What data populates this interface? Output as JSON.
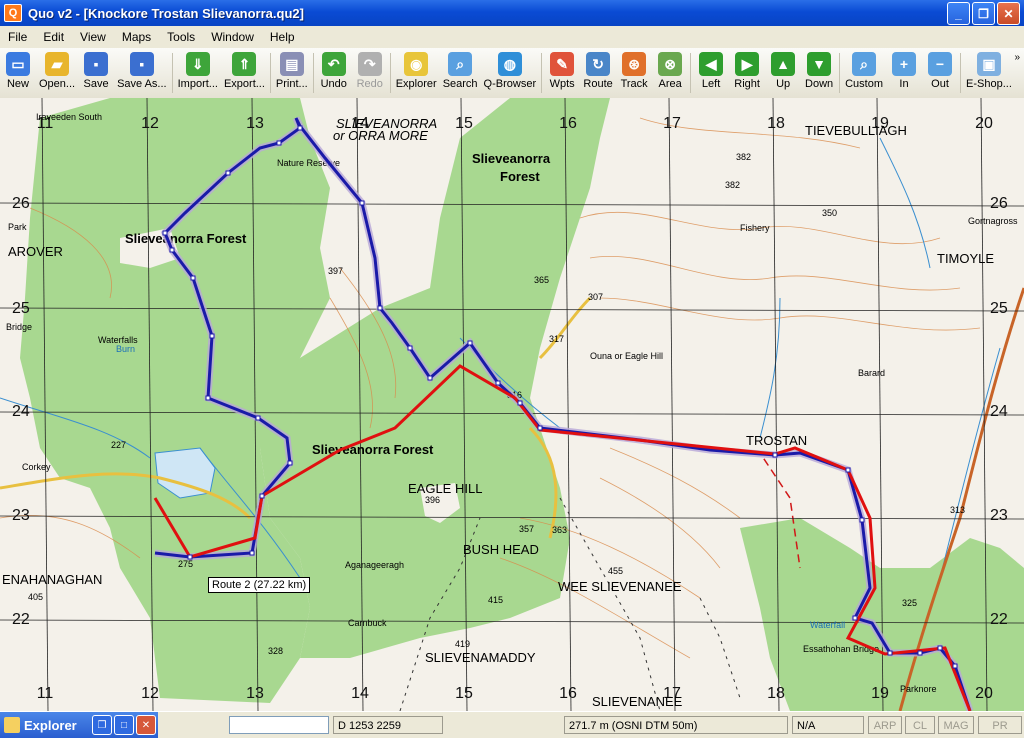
{
  "window": {
    "title": "Quo v2 - [Knockore Trostan Slievanorra.qu2]",
    "app_icon_letter": "Q",
    "min_label": "_",
    "max_label": "❐",
    "close_label": "✕"
  },
  "menu": [
    "File",
    "Edit",
    "View",
    "Maps",
    "Tools",
    "Window",
    "Help"
  ],
  "toolbar": [
    {
      "label": "New",
      "icon": "new-doc-icon",
      "color": "#3b7be0"
    },
    {
      "label": "Open...",
      "icon": "folder-icon",
      "color": "#e8b52c"
    },
    {
      "label": "Save",
      "icon": "floppy-icon",
      "color": "#3b6fd0"
    },
    {
      "label": "Save As...",
      "icon": "floppy-as-icon",
      "color": "#3b6fd0"
    },
    {
      "label": "Import...",
      "icon": "import-icon",
      "color": "#3ea53a"
    },
    {
      "label": "Export...",
      "icon": "export-icon",
      "color": "#3ea53a"
    },
    {
      "label": "Print...",
      "icon": "printer-icon",
      "color": "#8a8fb5"
    },
    {
      "label": "Undo",
      "icon": "undo-arrow-icon",
      "color": "#3ea53a"
    },
    {
      "label": "Redo",
      "icon": "redo-arrow-icon",
      "color": "#b0b0b0",
      "disabled": true
    },
    {
      "label": "Explorer",
      "icon": "explorer-icon",
      "color": "#e8c53a"
    },
    {
      "label": "Search",
      "icon": "search-icon",
      "color": "#5aa0e0"
    },
    {
      "label": "Q-Browser",
      "icon": "globe-icon",
      "color": "#2f8fd8"
    },
    {
      "label": "Wpts",
      "icon": "waypoint-icon",
      "color": "#e0533a"
    },
    {
      "label": "Route",
      "icon": "route-icon",
      "color": "#4a86c8"
    },
    {
      "label": "Track",
      "icon": "track-icon",
      "color": "#e0702a"
    },
    {
      "label": "Area",
      "icon": "area-icon",
      "color": "#6aa84f"
    },
    {
      "label": "Left",
      "icon": "arrow-left-icon",
      "color": "#2e9e2e"
    },
    {
      "label": "Right",
      "icon": "arrow-right-icon",
      "color": "#2e9e2e"
    },
    {
      "label": "Up",
      "icon": "arrow-up-icon",
      "color": "#2e9e2e"
    },
    {
      "label": "Down",
      "icon": "arrow-down-icon",
      "color": "#2e9e2e"
    },
    {
      "label": "Custom",
      "icon": "zoom-custom-icon",
      "color": "#5aa0e0"
    },
    {
      "label": "In",
      "icon": "zoom-in-icon",
      "color": "#5aa0e0"
    },
    {
      "label": "Out",
      "icon": "zoom-out-icon",
      "color": "#5aa0e0"
    },
    {
      "label": "E-Shop...",
      "icon": "shop-icon",
      "color": "#7fb0e0"
    }
  ],
  "map": {
    "grid_top": [
      "11",
      "12",
      "13",
      "14",
      "15",
      "16",
      "17",
      "18",
      "19",
      "20"
    ],
    "grid_bottom": [
      "11",
      "12",
      "13",
      "14",
      "15",
      "16",
      "17",
      "18",
      "19",
      "20"
    ],
    "grid_left": [
      "26",
      "25",
      "24",
      "23",
      "22"
    ],
    "grid_right": [
      "26",
      "25",
      "24",
      "23",
      "22"
    ],
    "labels_large": [
      "SLIEVEANORRA",
      "or ORRA MORE",
      "TIEVEBULLIAGH",
      "TIMOYLE",
      "TROSTAN",
      "EAGLE HILL",
      "BUSH HEAD",
      "WEE SLIEVENANEE",
      "SLIEVENAMADDY",
      "SLIEVENANEE",
      "ENAHANAGHAN",
      "AROVER"
    ],
    "labels_forest": [
      "Slieveanorra Forest",
      "Slieveanorra",
      "Forest",
      "Slieveanorra Forest"
    ],
    "labels_small": [
      "Iraveeden South",
      "Nature Reserve",
      "Fishery",
      "Gortnagross",
      "Ouna or Eagle Hill",
      "Barard",
      "Aganageeragh",
      "Carnbuck",
      "Essathohan Bridge",
      "Parknore",
      "Corkey",
      "Bridge",
      "Park",
      "Waterfalls",
      "Waterfall",
      "Burn"
    ],
    "heights": [
      "382",
      "382",
      "397",
      "365",
      "307",
      "317",
      "316",
      "396",
      "357",
      "363",
      "455",
      "419",
      "415",
      "313",
      "325",
      "328",
      "275",
      "227",
      "405",
      "350"
    ],
    "route_color": "#1a1aa8",
    "track_color": "#e01010",
    "forest_color": "#a8d890",
    "contour_color": "#d98a4a"
  },
  "route_tooltip": "Route 2 (27.22 km)",
  "status": {
    "explorer_label": "Explorer",
    "field_coords": "D 1253 2259",
    "field_height": "271.7 m (OSNI DTM 50m)",
    "field_na": "N/A",
    "flag_arp": "ARP",
    "flag_cl": "CL",
    "flag_mag": "MAG",
    "flag_pr": "PR"
  }
}
